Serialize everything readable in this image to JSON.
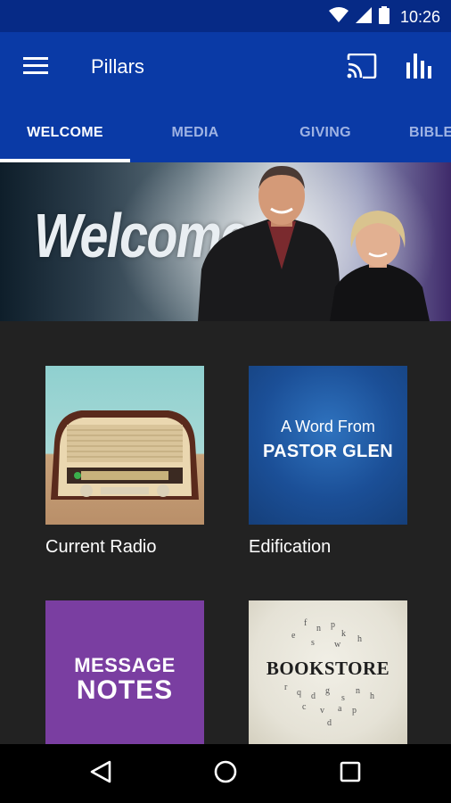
{
  "status_bar": {
    "time": "10:26",
    "icons": [
      "wifi-icon",
      "cell-signal-icon",
      "battery-icon"
    ]
  },
  "app_bar": {
    "title": "Pillars",
    "icons": [
      "menu-icon",
      "cast-icon",
      "equalizer-icon"
    ]
  },
  "tabs": [
    {
      "label": "WELCOME",
      "active": true
    },
    {
      "label": "MEDIA",
      "active": false
    },
    {
      "label": "GIVING",
      "active": false
    },
    {
      "label": "BIBLE",
      "active": false
    }
  ],
  "hero": {
    "title": "Welcome"
  },
  "tiles": [
    {
      "label": "Current Radio"
    },
    {
      "label": "Edification",
      "art_line1": "A Word From",
      "art_line2": "PASTOR GLEN"
    },
    {
      "art_line1": "MESSAGE",
      "art_line2": "NOTES"
    },
    {
      "art_text": "BOOKSTORE"
    }
  ],
  "nav_bar": {
    "icons": [
      "back-icon",
      "home-icon",
      "recents-icon"
    ]
  },
  "colors": {
    "status_bar": "#062a86",
    "app_bar": "#0a3aa6",
    "background": "#222222",
    "tab_inactive": "#9fb3e3",
    "message_notes": "#7a3ea1"
  }
}
